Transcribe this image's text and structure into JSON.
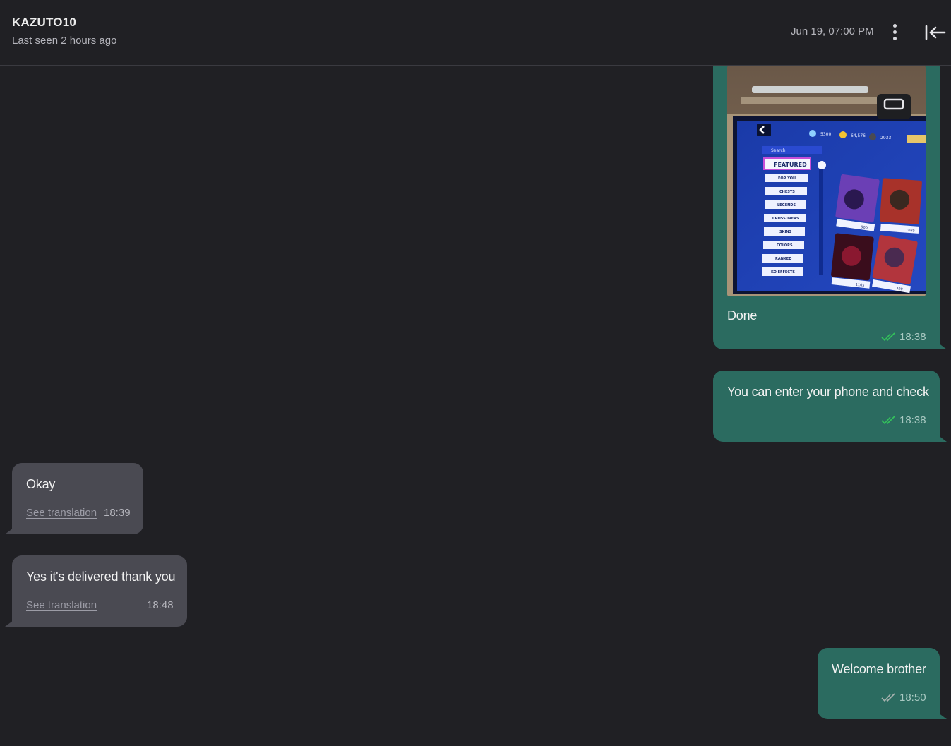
{
  "header": {
    "contact_name": "KAZUTO10",
    "status": "Last seen 2 hours ago",
    "date": "Jun 19, 07:00 PM",
    "menu_icon": "more-vertical-icon",
    "collapse_icon": "arrow-left-to-line-icon"
  },
  "messages": [
    {
      "direction": "outgoing",
      "type": "image",
      "caption": "Done",
      "time": "18:38",
      "status": "read",
      "image": {
        "search_placeholder": "Search",
        "currency": [
          "5300",
          "64,576",
          "2933"
        ],
        "menu_items": [
          "FEATURED",
          "FOR YOU",
          "CHESTS",
          "LEGENDS",
          "CROSSOVERS",
          "SKINS",
          "COLORS",
          "RANKED",
          "KO EFFECTS"
        ],
        "prices": [
          "900",
          "1085",
          "1165",
          "390"
        ]
      }
    },
    {
      "direction": "outgoing",
      "type": "text",
      "text": "You can enter your phone and check",
      "time": "18:38",
      "status": "read"
    },
    {
      "direction": "incoming",
      "type": "text",
      "text": "Okay",
      "translate_label": "See translation",
      "time": "18:39"
    },
    {
      "direction": "incoming",
      "type": "text",
      "text": "Yes it's delivered thank you",
      "translate_label": "See translation",
      "time": "18:48"
    },
    {
      "direction": "outgoing",
      "type": "text",
      "text": "Welcome brother",
      "time": "18:50",
      "status": "delivered"
    }
  ],
  "colors": {
    "background": "#202024",
    "outgoing_bubble": "#2b6b60",
    "incoming_bubble": "#4a4a52",
    "read_ticks": "#33c45a",
    "delivered_ticks": "#a9b3b0"
  }
}
